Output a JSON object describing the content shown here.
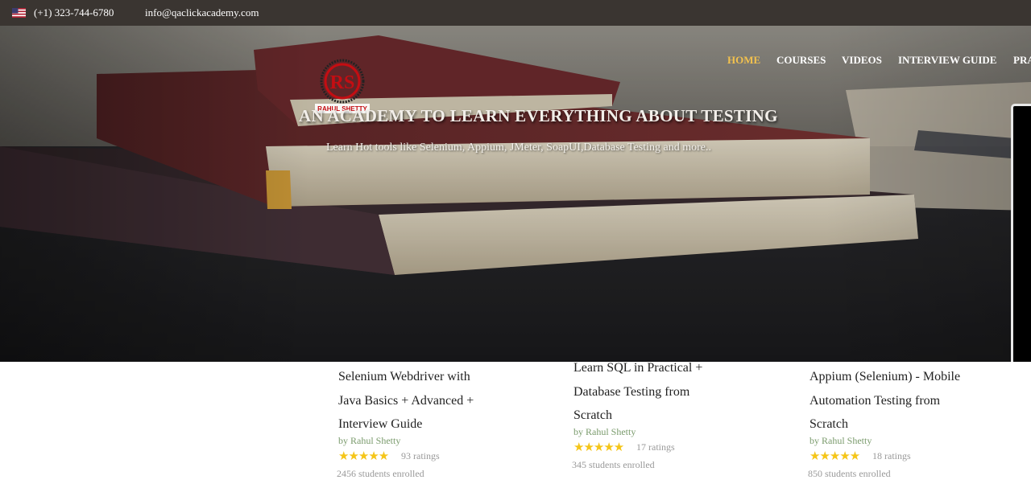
{
  "topbar": {
    "phone": "(+1) 323-744-6780",
    "email": "info@qaclickacademy.com"
  },
  "logo": {
    "text": "RAHUL SHETTY"
  },
  "nav": {
    "items": [
      "HOME",
      "COURSES",
      "VIDEOS",
      "INTERVIEW GUIDE",
      "PRA"
    ],
    "active_color": "#f2c14e"
  },
  "hero": {
    "title": "AN ACADEMY TO LEARN EVERYTHING ABOUT TESTING",
    "subtitle": "Learn Hot tools like Selenium, Appium, JMeter, SoapUI,Database Testing and more.."
  },
  "courses": [
    {
      "title_lines": [
        "Selenium Webdriver with",
        "Java Basics + Advanced +",
        "Interview Guide"
      ],
      "author": "by Rahul Shetty",
      "stars": "★★★★★",
      "ratings": "93 ratings",
      "enrolled": "2456 students enrolled"
    },
    {
      "title_lines": [
        "Learn SQL in Practical +",
        "Database Testing from",
        "Scratch"
      ],
      "author": "by Rahul Shetty",
      "stars": "★★★★★",
      "ratings": "17 ratings",
      "enrolled": "345 students enrolled"
    },
    {
      "title_lines": [
        "Appium (Selenium) - Mobile",
        "Automation Testing from",
        "Scratch"
      ],
      "author": "by Rahul Shetty",
      "stars": "★★★★★",
      "ratings": "18 ratings",
      "enrolled": "850 students enrolled"
    }
  ]
}
